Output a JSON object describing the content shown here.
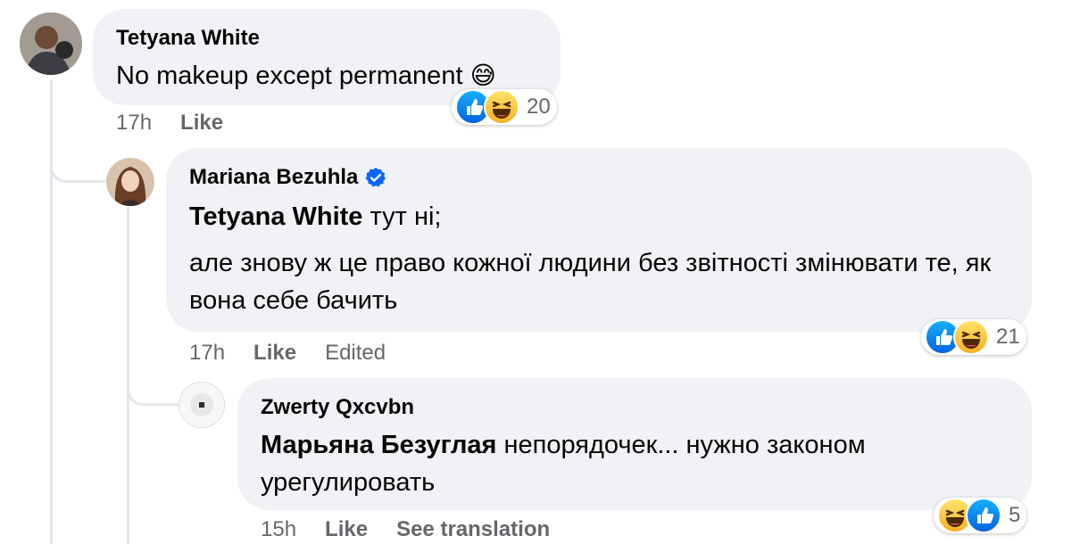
{
  "comments": [
    {
      "author": "Tetyana White",
      "text": "No makeup except permanent",
      "emoji": "😅",
      "time": "17h",
      "like_label": "Like",
      "reaction_count": "20",
      "reactions": [
        "like",
        "haha"
      ]
    },
    {
      "author": "Mariana Bezuhla",
      "verified": true,
      "mention": "Tetyana White",
      "line1_rest": " тут ні;",
      "paragraph2": "але знову ж це право кожної людини без звітності змінювати те, як вона себе бачить",
      "time": "17h",
      "like_label": "Like",
      "edited_label": "Edited",
      "reaction_count": "21",
      "reactions": [
        "like",
        "haha"
      ]
    },
    {
      "author": "Zwerty Qxcvbn",
      "mention": "Марьяна Безуглая",
      "text_rest": " непорядочек... нужно законом урегулировать",
      "time": "15h",
      "like_label": "Like",
      "translate_label": "See translation",
      "reaction_count": "5",
      "reactions": [
        "haha",
        "like"
      ]
    }
  ],
  "colors": {
    "bubble": "#f0f2f5",
    "meta_text": "#65676b",
    "verified": "#0866ff",
    "thread_line": "#e4e6eb"
  }
}
